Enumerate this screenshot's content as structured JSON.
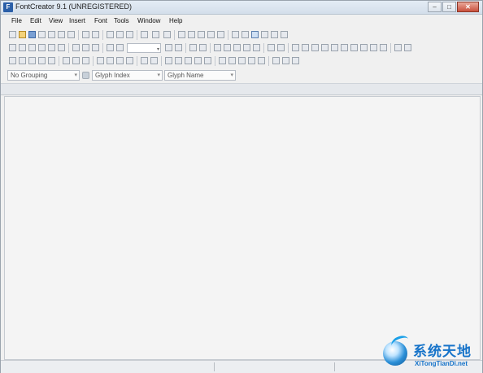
{
  "window": {
    "title": "FontCreator 9.1 (UNREGISTERED)",
    "app_icon_glyph": "F",
    "controls": {
      "minimize": "–",
      "maximize": "□",
      "close": "✕"
    }
  },
  "menubar": {
    "items": [
      {
        "id": "file",
        "label": "File"
      },
      {
        "id": "edit",
        "label": "Edit"
      },
      {
        "id": "view",
        "label": "View"
      },
      {
        "id": "insert",
        "label": "Insert"
      },
      {
        "id": "font",
        "label": "Font"
      },
      {
        "id": "tools",
        "label": "Tools"
      },
      {
        "id": "window",
        "label": "Window"
      },
      {
        "id": "help",
        "label": "Help"
      }
    ]
  },
  "toolbar": {
    "zoom_value": ""
  },
  "filters": {
    "grouping": "No Grouping",
    "sort_primary": "Glyph Index",
    "sort_secondary": "Glyph Name",
    "dropdown_arrow": "▾"
  },
  "watermark": {
    "text_cn": "系统天地",
    "text_en": "XiTongTianDi.net"
  },
  "icons": [
    "app-font-icon",
    "new-icon",
    "open-folder-icon",
    "save-icon",
    "print-icon",
    "undo-icon",
    "redo-icon",
    "zoom-icon",
    "glyph-tool-icon"
  ]
}
